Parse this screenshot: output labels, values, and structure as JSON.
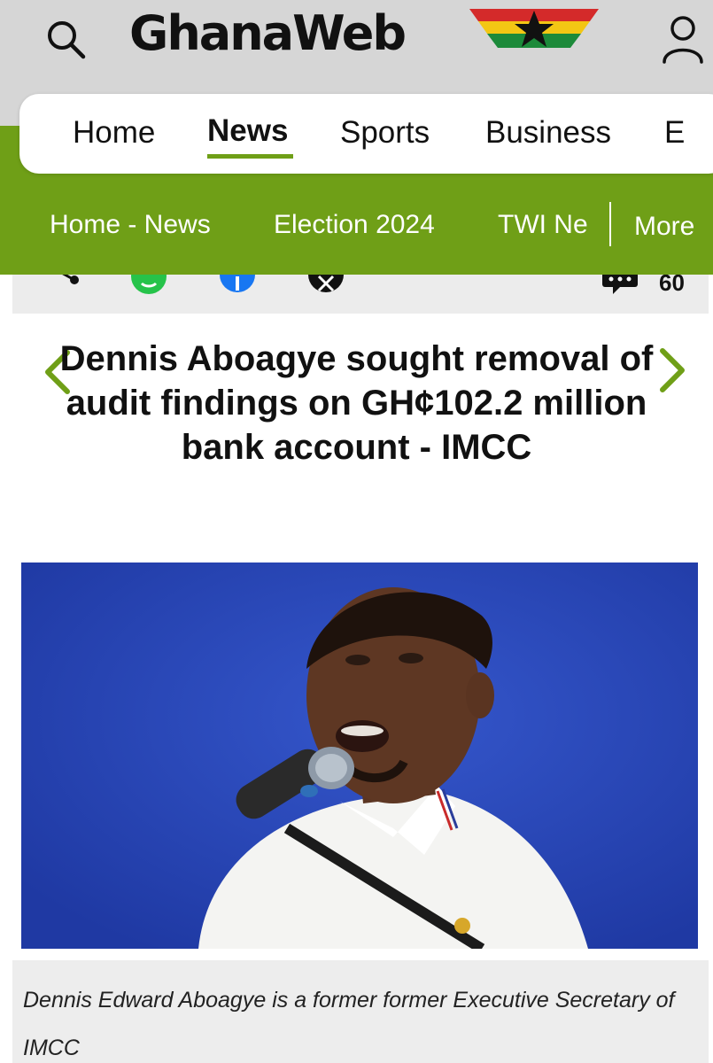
{
  "header": {
    "logo_text": "GhanaWeb",
    "icons": {
      "search": "search-icon",
      "account": "user-icon"
    }
  },
  "main_nav": {
    "items": [
      {
        "label": "Home",
        "active": false
      },
      {
        "label": "News",
        "active": true
      },
      {
        "label": "Sports",
        "active": false
      },
      {
        "label": "Business",
        "active": false
      },
      {
        "label": "E",
        "active": false
      }
    ]
  },
  "sub_nav": {
    "items": [
      {
        "label": "Home - News"
      },
      {
        "label": "Election 2024"
      },
      {
        "label": "TWI Ne"
      },
      {
        "label": "More"
      }
    ]
  },
  "share_bar": {
    "icons": [
      "share-icon",
      "whatsapp-icon",
      "facebook-icon",
      "x-icon",
      "comments-icon"
    ],
    "comment_count": "60"
  },
  "article": {
    "title": "Dennis Aboagye sought removal of audit findings on GH¢102.2 million bank account - IMCC",
    "caption": "Dennis Edward Aboagye is a former former Executive Secretary of IMCC"
  },
  "colors": {
    "brand_green": "#6f9f17",
    "header_gray": "#d6d6d6",
    "photo_background": "#2847b8"
  }
}
